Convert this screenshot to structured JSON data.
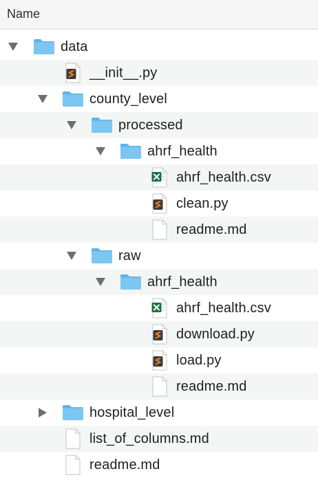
{
  "header": {
    "name_column": "Name"
  },
  "tree": {
    "rows": [
      {
        "label": "data",
        "icon": "folder-icon",
        "disclosure": "expanded"
      },
      {
        "label": "__init__.py",
        "icon": "python-file-icon"
      },
      {
        "label": "county_level",
        "icon": "folder-icon",
        "disclosure": "expanded"
      },
      {
        "label": "processed",
        "icon": "folder-icon",
        "disclosure": "expanded"
      },
      {
        "label": "ahrf_health",
        "icon": "folder-icon",
        "disclosure": "expanded"
      },
      {
        "label": "ahrf_health.csv",
        "icon": "excel-csv-icon"
      },
      {
        "label": "clean.py",
        "icon": "python-file-icon"
      },
      {
        "label": "readme.md",
        "icon": "markdown-file-icon"
      },
      {
        "label": "raw",
        "icon": "folder-icon",
        "disclosure": "expanded"
      },
      {
        "label": "ahrf_health",
        "icon": "folder-icon",
        "disclosure": "expanded"
      },
      {
        "label": "ahrf_health.csv",
        "icon": "excel-csv-icon"
      },
      {
        "label": "download.py",
        "icon": "python-file-icon"
      },
      {
        "label": "load.py",
        "icon": "python-file-icon"
      },
      {
        "label": "readme.md",
        "icon": "markdown-file-icon"
      },
      {
        "label": "hospital_level",
        "icon": "folder-icon",
        "disclosure": "collapsed"
      },
      {
        "label": "list_of_columns.md",
        "icon": "markdown-file-icon"
      },
      {
        "label": "readme.md",
        "icon": "markdown-file-icon"
      }
    ]
  },
  "colors": {
    "folder": "#7cc6f2",
    "folder_tab": "#5fb3e8",
    "row_alt": "#f4f5f5",
    "disclosure": "#6f6f6f",
    "python_badge": "#e87a1e",
    "excel_badge": "#1e7145"
  }
}
